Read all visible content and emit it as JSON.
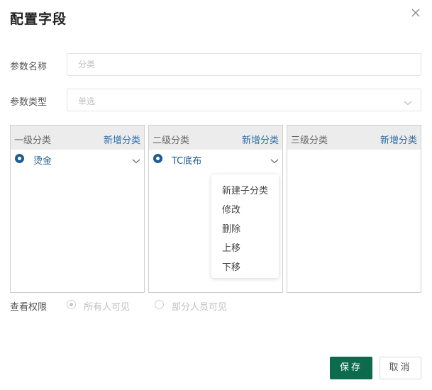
{
  "dialog": {
    "title": "配置字段",
    "close_icon": "close-icon"
  },
  "form": {
    "param_name": {
      "label": "参数名称",
      "value": "",
      "placeholder": "分类"
    },
    "param_type": {
      "label": "参数类型",
      "value": "单选"
    }
  },
  "panels": [
    {
      "title": "一级分类",
      "add_label": "新增分类",
      "items": [
        {
          "label": "烫金",
          "selected": true
        }
      ]
    },
    {
      "title": "二级分类",
      "add_label": "新增分类",
      "items": [
        {
          "label": "TC底布",
          "selected": true
        }
      ]
    },
    {
      "title": "三级分类",
      "add_label": "新增分类",
      "items": []
    }
  ],
  "context_menu": {
    "items": [
      "新建子分类",
      "修改",
      "删除",
      "上移",
      "下移"
    ]
  },
  "permission": {
    "label": "查看权限",
    "options": [
      {
        "label": "所有人可见",
        "selected": true
      },
      {
        "label": "部分人员可见",
        "selected": false
      }
    ]
  },
  "actions": {
    "save_label": "保存",
    "cancel_label": "取消"
  },
  "colors": {
    "primary": "#0c6b4d",
    "link": "#2d6ca7",
    "selected": "#1f5c94"
  }
}
